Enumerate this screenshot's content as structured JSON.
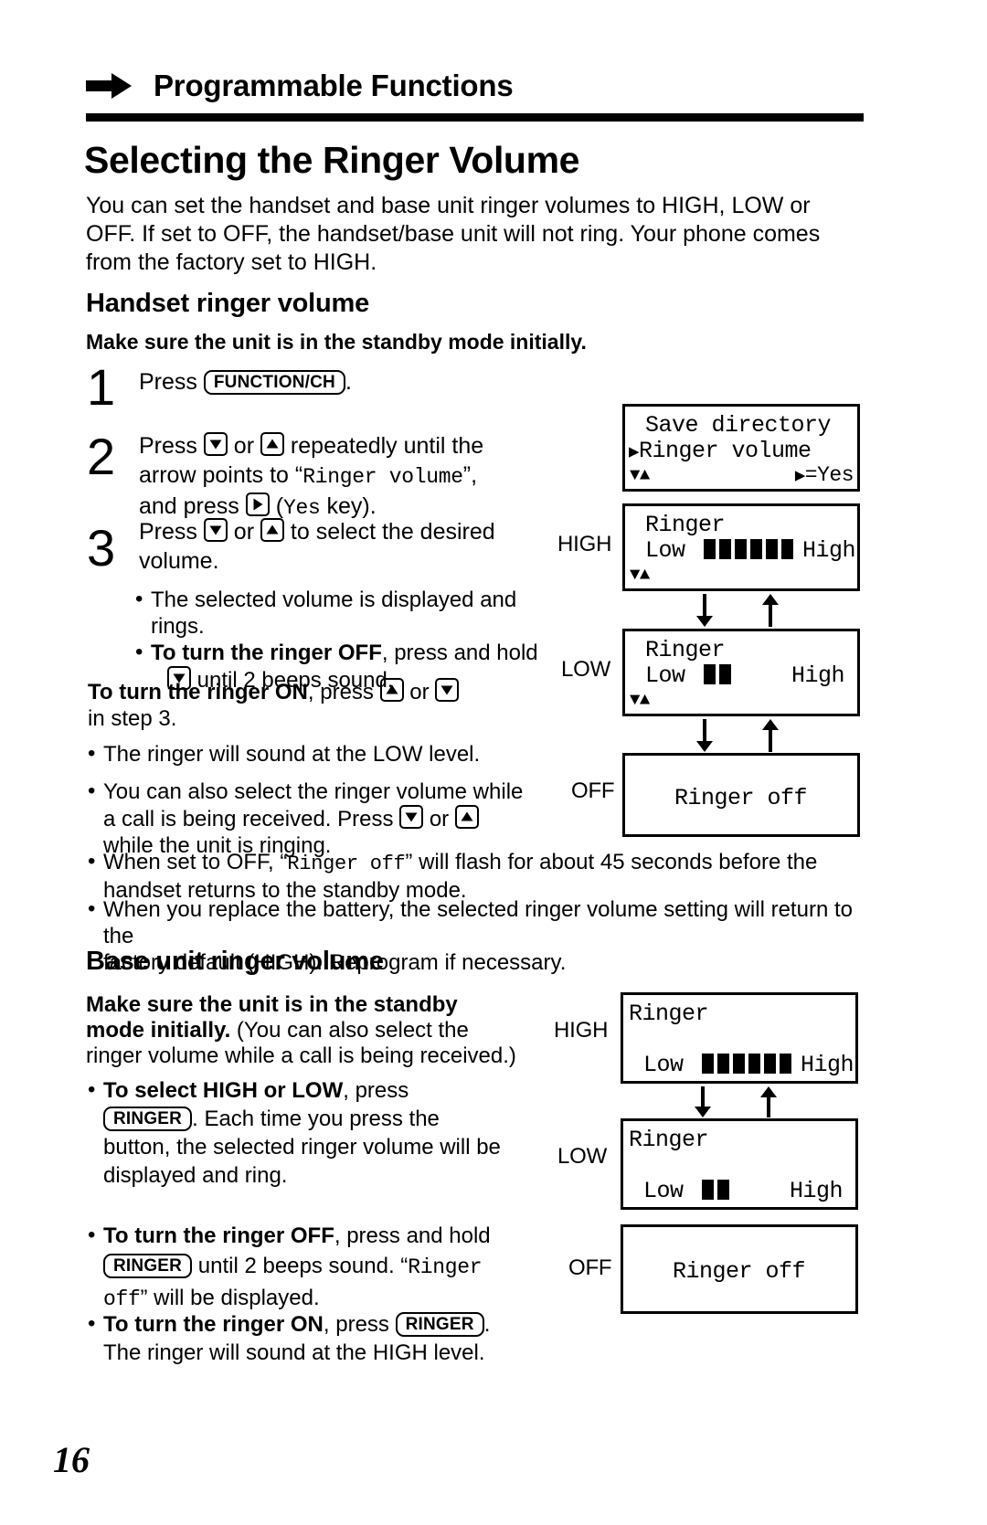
{
  "header": {
    "arrow_icon": "right-arrow-icon",
    "title": "Programmable Functions"
  },
  "page_title": "Selecting the Ringer Volume",
  "intro": "You can set the handset and base unit ringer volumes to HIGH, LOW or OFF. If set to OFF, the handset/base unit will not ring. Your phone comes from the factory set to HIGH.",
  "handset": {
    "heading": "Handset ringer volume",
    "standby_note": "Make sure the unit is in the standby mode initially.",
    "steps": [
      {
        "number": "1",
        "pre": "Press ",
        "key": "FUNCTION/CH",
        "post": "."
      },
      {
        "number": "2",
        "line1_a": "Press ",
        "line1_b": " or ",
        "line1_c": " repeatedly until the",
        "line2_a": "arrow points to “",
        "line2_mono": "Ringer volume",
        "line2_b": "”,",
        "line3_a": "and press ",
        "line3_b": " (",
        "line3_mono": "Yes",
        "line3_c": " key)."
      },
      {
        "number": "3",
        "line1_a": "Press ",
        "line1_b": " or ",
        "line1_c": " to select the desired",
        "line2": "volume."
      }
    ],
    "step3_bullets": [
      "The selected volume is displayed and rings.",
      "To turn the ringer OFF"
    ],
    "bullet1": "The selected volume is displayed and rings.",
    "bullet2_bold": "To turn the ringer OFF",
    "bullet2_rest": ", press and hold",
    "bullet2_line2": " until 2 beeps sound.",
    "ringer_on_bold": "To turn the ringer ON",
    "ringer_on_mid": ", press ",
    "ringer_on_or": " or ",
    "ringer_on_line2": "in step 3.",
    "bullet3": "The ringer will sound at the LOW level.",
    "bullet4_line1": "You can also select the ringer volume while",
    "bullet4_line2_a": "a call is being received. Press ",
    "bullet4_line2_or": " or ",
    "bullet4_line3": "while the unit is ringing.",
    "bullet5_a": "When set to OFF, “",
    "bullet5_mono": "Ringer off",
    "bullet5_b": "” will flash for about 45 seconds before the",
    "bullet5_line2": "handset returns to the standby mode.",
    "bullet6_line1": "When you replace the battery, the selected ringer volume setting will return to the",
    "bullet6_line2": "factory default (HIGH). Reprogram if necessary."
  },
  "base": {
    "heading": "Base unit ringer volume",
    "standby_bold": "Make sure the unit is in the standby",
    "standby_bold2": "mode initially.",
    "standby_rest": " (You can also select the",
    "standby_line3": "ringer volume while a call is being received.)",
    "b1_bold": "To select HIGH or LOW",
    "b1_rest": ", press",
    "b1_key": "RINGER",
    "b1_line2_rest": ". Each time you press the",
    "b1_line3": "button, the selected ringer volume will be",
    "b1_line4": "displayed and ring.",
    "b2_bold": "To turn the ringer OFF",
    "b2_rest": ", press and hold",
    "b2_key": "RINGER",
    "b2_line2_rest": " until 2 beeps sound. “",
    "b2_mono": "Ringer",
    "b2_mono2": "off",
    "b2_line3_rest": "” will be displayed.",
    "b3_bold": "To turn the ringer ON",
    "b3_rest": ", press ",
    "b3_key": "RINGER",
    "b3_post": ".",
    "b3_line2": "The ringer will sound at the HIGH level."
  },
  "displays": {
    "menu": {
      "line1": "Save directory",
      "line2_arrow": "▶",
      "line2": "Ringer volume",
      "line3_down": "▼",
      "line3_up": "▲",
      "line3_right": "▶",
      "line3_yes": "=Yes"
    },
    "handset_high": {
      "side_label": "HIGH",
      "title": "Ringer",
      "low_label": "Low",
      "high_label": "High",
      "bars": 6,
      "nav_down": "▼",
      "nav_up": "▲"
    },
    "handset_low": {
      "side_label": "LOW",
      "title": "Ringer",
      "low_label": "Low",
      "high_label": "High",
      "bars": 2,
      "nav_down": "▼",
      "nav_up": "▲"
    },
    "handset_off": {
      "side_label": "OFF",
      "text": "Ringer off"
    },
    "base_high": {
      "side_label": "HIGH",
      "title": "Ringer",
      "low_label": "Low",
      "high_label": "High",
      "bars": 6
    },
    "base_low": {
      "side_label": "LOW",
      "title": "Ringer",
      "low_label": "Low",
      "high_label": "High",
      "bars": 2
    },
    "base_off": {
      "side_label": "OFF",
      "text": "Ringer off"
    }
  },
  "page_number": "16",
  "colors": {
    "ink": "#000000",
    "paper": "#ffffff"
  }
}
